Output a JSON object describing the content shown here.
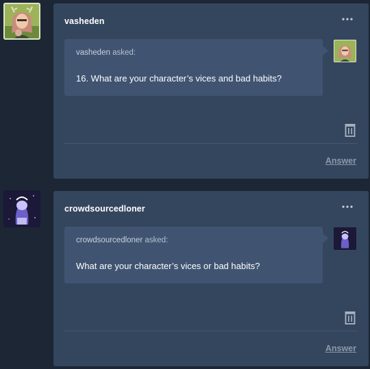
{
  "posts": [
    {
      "username": "vasheden",
      "asker": "vasheden",
      "asked_label": " asked:",
      "question": "16. What are your character’s vices and bad habits?",
      "answer_label": "Answer"
    },
    {
      "username": "crowdsourcedloner",
      "asker": "crowdsourcedloner",
      "asked_label": " asked:",
      "question": "What are your character’s vices or bad habits?",
      "answer_label": "Answer"
    }
  ],
  "colors": {
    "background": "#1c2634",
    "card": "#34465e",
    "ask_bubble": "#405472",
    "answer_link": "#8b98aa"
  },
  "icons": {
    "more": "ellipsis-icon",
    "delete": "trash-icon"
  }
}
